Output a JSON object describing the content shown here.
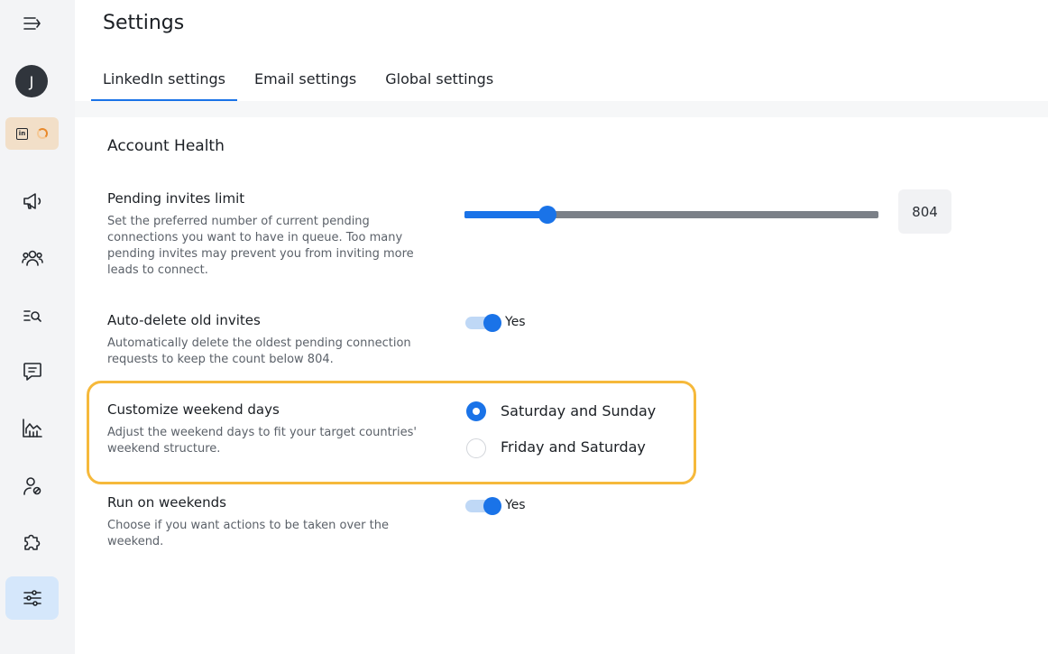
{
  "header": {
    "title": "Settings"
  },
  "tabs": [
    {
      "label": "LinkedIn settings",
      "active": true
    },
    {
      "label": "Email settings",
      "active": false
    },
    {
      "label": "Global settings",
      "active": false
    }
  ],
  "sidebar": {
    "avatar_initial": "J",
    "linkedin_badge": "in",
    "items": [
      {
        "icon": "menu-collapse-icon"
      },
      {
        "icon": "megaphone-icon"
      },
      {
        "icon": "users-icon"
      },
      {
        "icon": "list-search-icon"
      },
      {
        "icon": "chat-icon"
      },
      {
        "icon": "analytics-chart-icon"
      },
      {
        "icon": "user-blocked-icon"
      },
      {
        "icon": "puzzle-icon"
      },
      {
        "icon": "sliders-icon",
        "active": true
      }
    ]
  },
  "section": {
    "title": "Account Health"
  },
  "pending_invites": {
    "title": "Pending invites limit",
    "description": "Set the preferred number of current pending connections you want to have in queue. Too many pending invites may prevent you from inviting more leads to connect.",
    "value": "804",
    "slider_fraction": 0.2
  },
  "auto_delete": {
    "title": "Auto-delete old invites",
    "description": "Automatically delete the oldest pending connection requests to keep the count below 804.",
    "toggle_label": "Yes",
    "enabled": true
  },
  "weekend_days": {
    "title": "Customize weekend days",
    "description": "Adjust the weekend days to fit your target countries' weekend structure.",
    "options": [
      {
        "label": "Saturday and Sunday",
        "selected": true
      },
      {
        "label": "Friday and Saturday",
        "selected": false
      }
    ]
  },
  "run_weekends": {
    "title": "Run on weekends",
    "description": "Choose if you want actions to be taken over the weekend.",
    "toggle_label": "Yes",
    "enabled": true
  },
  "colors": {
    "accent": "#1a73e8",
    "highlight": "#f6b93b",
    "sidebar_bg": "#f3f4f6",
    "active_item_bg": "#d5e7fb"
  }
}
